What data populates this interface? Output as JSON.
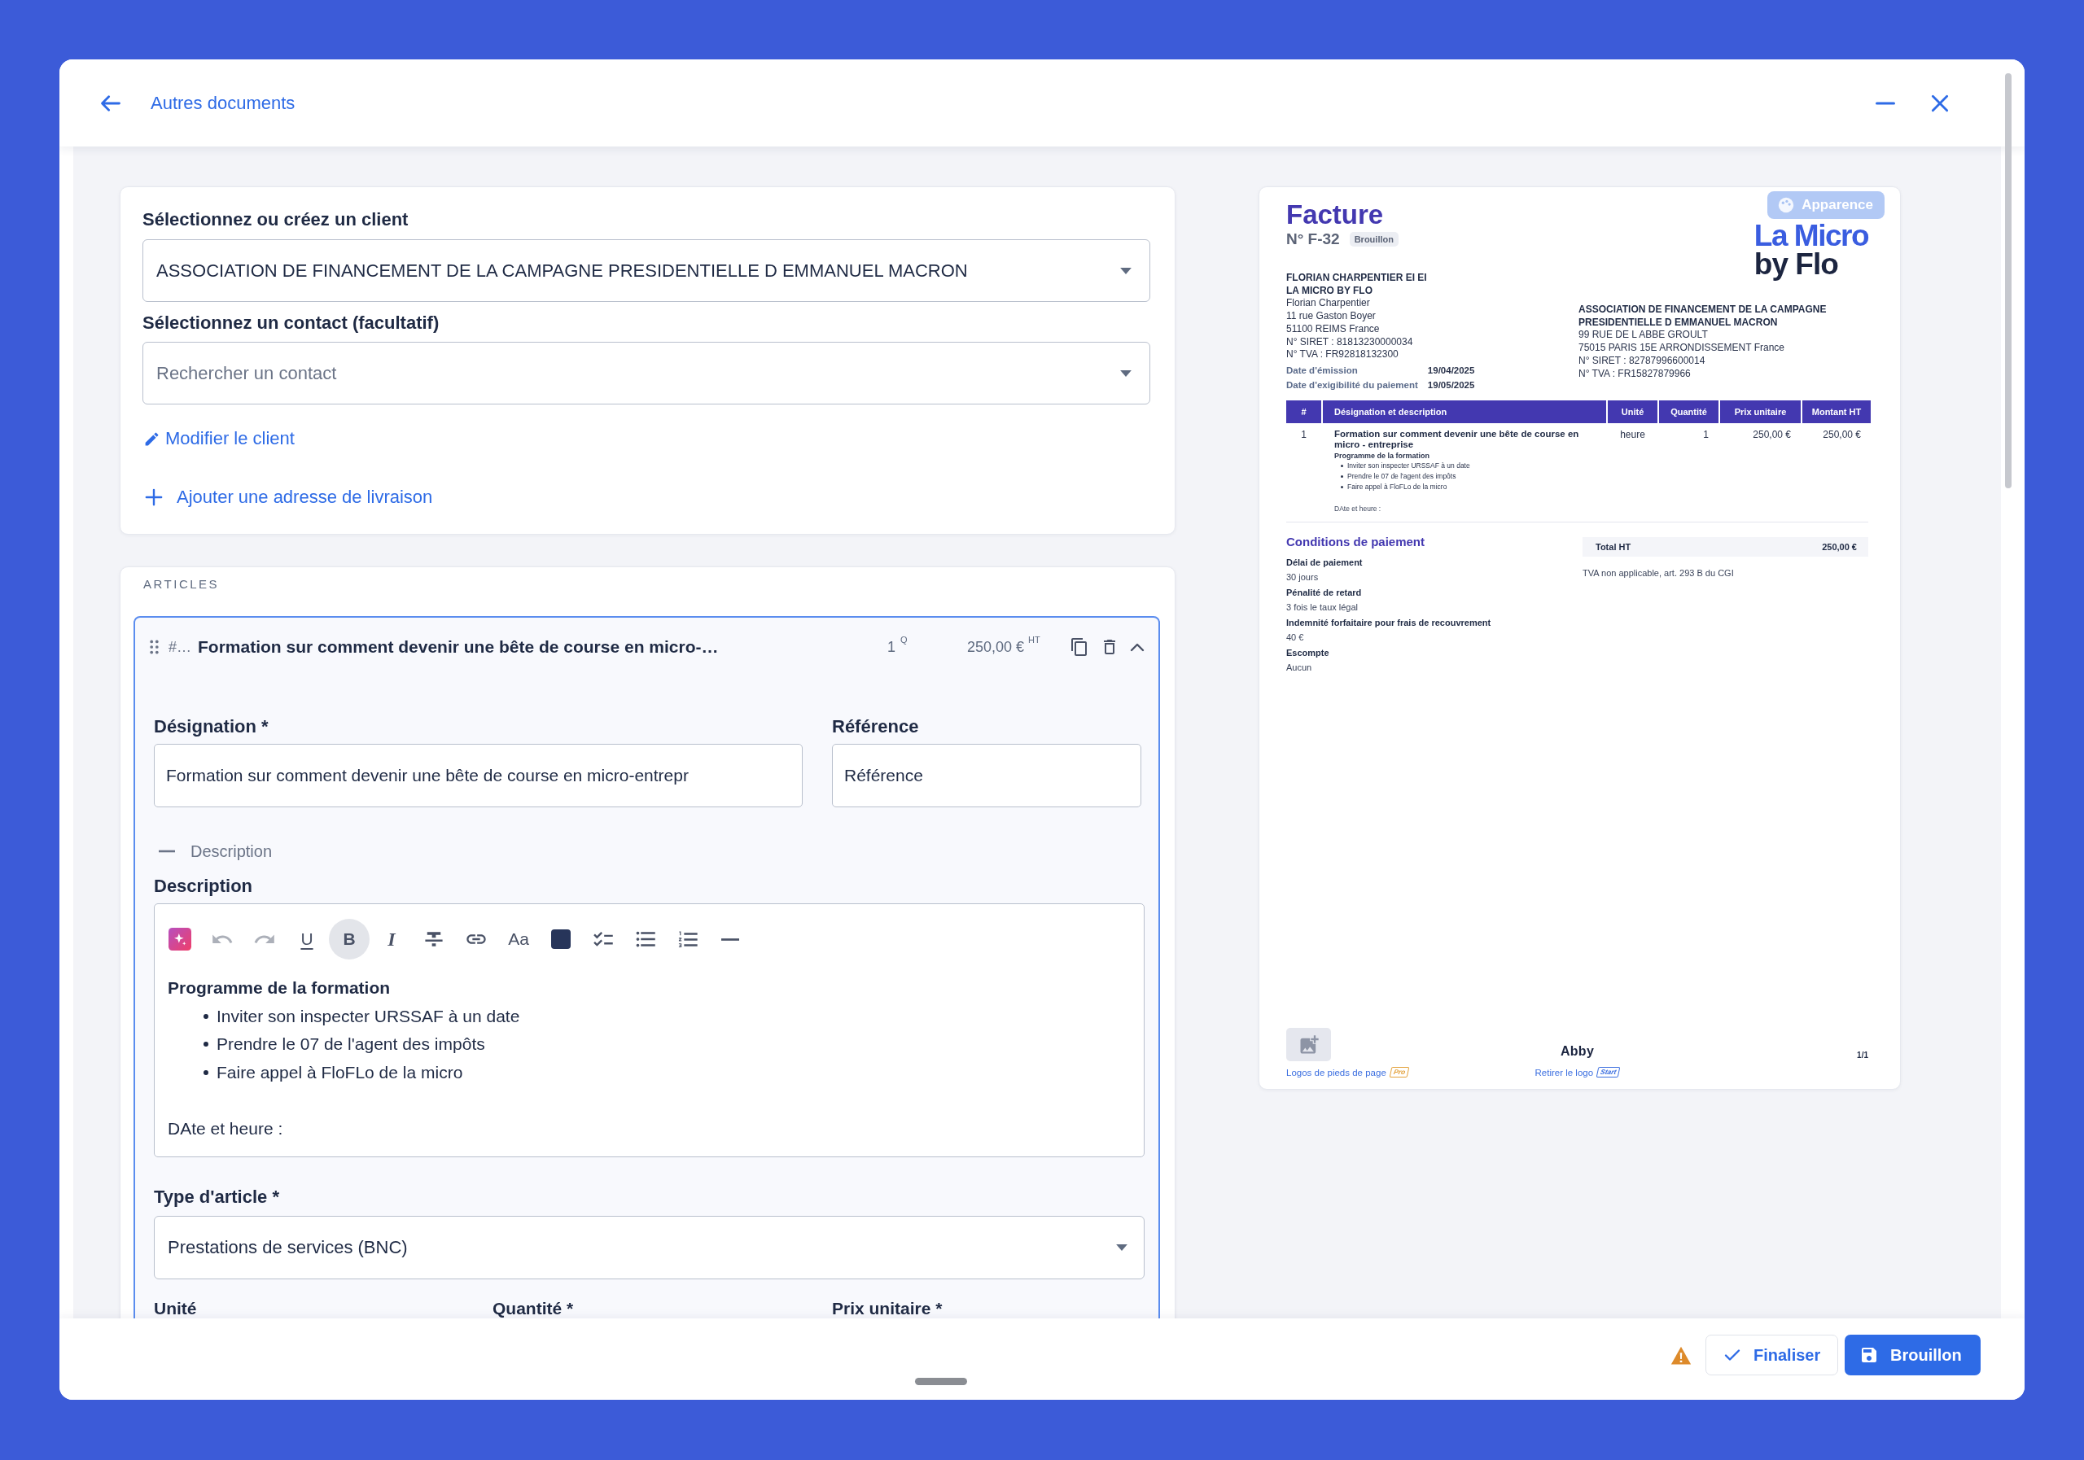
{
  "window": {
    "back_link": "Autres documents"
  },
  "client_card": {
    "client_label": "Sélectionnez ou créez un client",
    "client_value": "ASSOCIATION DE FINANCEMENT DE LA CAMPAGNE PRESIDENTIELLE D EMMANUEL MACRON",
    "contact_label": "Sélectionnez un contact (facultatif)",
    "contact_placeholder": "Rechercher un contact",
    "edit_link": "Modifier le client",
    "add_address_link": "Ajouter une adresse de livraison"
  },
  "articles": {
    "heading": "ARTICLES",
    "items": [
      {
        "expanded": true,
        "number": "#…",
        "title": "Formation sur comment devenir une bête de course en micro-…",
        "quantity": "1",
        "quantity_unit": "Q",
        "price": "250,00 €",
        "price_suffix": "HT",
        "designation_label": "Désignation *",
        "designation_value": "Formation sur comment devenir une bête de course en micro-entrepr",
        "reference_label": "Référence",
        "reference_placeholder": "Référence",
        "description_toggle": {
          "label": "Description",
          "expanded": true
        },
        "description_label": "Description",
        "toolbar": [
          {
            "kind": "ai",
            "active": false,
            "disabled": false
          },
          {
            "kind": "undo",
            "active": false,
            "disabled": true
          },
          {
            "kind": "redo",
            "active": false,
            "disabled": true
          },
          {
            "kind": "underline",
            "label": "U",
            "active": false,
            "disabled": false
          },
          {
            "kind": "bold",
            "label": "B",
            "active": true,
            "disabled": false
          },
          {
            "kind": "italic",
            "label": "I",
            "active": false,
            "disabled": false
          },
          {
            "kind": "strikethrough",
            "active": false,
            "disabled": false
          },
          {
            "kind": "link",
            "active": false,
            "disabled": false
          },
          {
            "kind": "font_size",
            "label": "Aa",
            "active": false,
            "disabled": false
          },
          {
            "kind": "color",
            "color": "#27355a",
            "active": false,
            "disabled": false
          },
          {
            "kind": "checklist",
            "active": false,
            "disabled": false
          },
          {
            "kind": "bullet_list",
            "active": false,
            "disabled": false
          },
          {
            "kind": "ordered_list",
            "active": false,
            "disabled": false
          },
          {
            "kind": "horizontal_rule",
            "active": false,
            "disabled": false
          }
        ],
        "content": {
          "heading": "Programme de la formation",
          "bullets": [
            "Inviter son inspecter URSSAF à un date",
            "Prendre le 07 de l'agent des impôts",
            "Faire appel à FloFLo de la micro"
          ],
          "note": "DAte et heure :"
        },
        "type_label": "Type d'article *",
        "type_value": "Prestations de services (BNC)",
        "field_labels": [
          "Unité",
          "Quantité *",
          "Prix unitaire *"
        ]
      }
    ]
  },
  "preview": {
    "title": "Facture",
    "number": "N° F-32",
    "status": "Brouillon",
    "appearance_button": "Apparence",
    "logo": [
      "La Micro",
      "by Flo"
    ],
    "seller": {
      "name_lines": [
        "FLORIAN CHARPENTIER EI EI",
        "LA MICRO BY FLO"
      ],
      "lines": [
        "Florian Charpentier",
        "11 rue Gaston Boyer",
        "51100 REIMS France",
        "N° SIRET : 81813230000034",
        "N° TVA : FR92818132300"
      ]
    },
    "dates": [
      {
        "label": "Date d'émission",
        "value": "19/04/2025"
      },
      {
        "label": "Date d'exigibilité du paiement",
        "value": "19/05/2025"
      }
    ],
    "client": {
      "name_lines": [
        "ASSOCIATION DE FINANCEMENT DE LA CAMPAGNE",
        "PRESIDENTIELLE D EMMANUEL MACRON"
      ],
      "lines": [
        "99 RUE DE L ABBE GROULT",
        "75015 PARIS 15E ARRONDISSEMENT France",
        "N° SIRET : 82787996600014",
        "N° TVA : FR15827879966"
      ]
    },
    "table": {
      "columns": [
        "#",
        "Désignation et description",
        "Unité",
        "Quantité",
        "Prix unitaire",
        "Montant HT"
      ],
      "rows": [
        {
          "number": "1",
          "title": "Formation sur comment devenir une bête de course en micro - entreprise",
          "program_title": "Programme de la formation",
          "bullets": [
            "Inviter son inspecter URSSAF à un date",
            "Prendre le 07 de l'agent des impôts",
            "Faire appel à FloFLo de la micro"
          ],
          "note": "DAte et heure :",
          "unit": "heure",
          "quantity": "1",
          "unit_price": "250,00 €",
          "amount": "250,00 €"
        }
      ]
    },
    "conditions": {
      "title": "Conditions de paiement",
      "items": [
        {
          "label": "Délai de paiement",
          "value": "30 jours"
        },
        {
          "label": "Pénalité de retard",
          "value": "3 fois le taux légal"
        },
        {
          "label": "Indemnité forfaitaire pour frais de recouvrement",
          "value": "40 €"
        },
        {
          "label": "Escompte",
          "value": "Aucun"
        }
      ]
    },
    "totals": [
      {
        "label": "Total HT",
        "value": "250,00 €"
      }
    ],
    "vat_note": "TVA non applicable, art. 293 B du CGI",
    "footer": {
      "logos_link": "Logos de pieds de page",
      "logos_badge": "Pro",
      "brand": "Abby",
      "remove_logo_link": "Retirer le logo",
      "remove_logo_badge": "Start",
      "page": "1/1"
    }
  },
  "actions": {
    "finalize": "Finaliser",
    "draft": "Brouillon"
  }
}
